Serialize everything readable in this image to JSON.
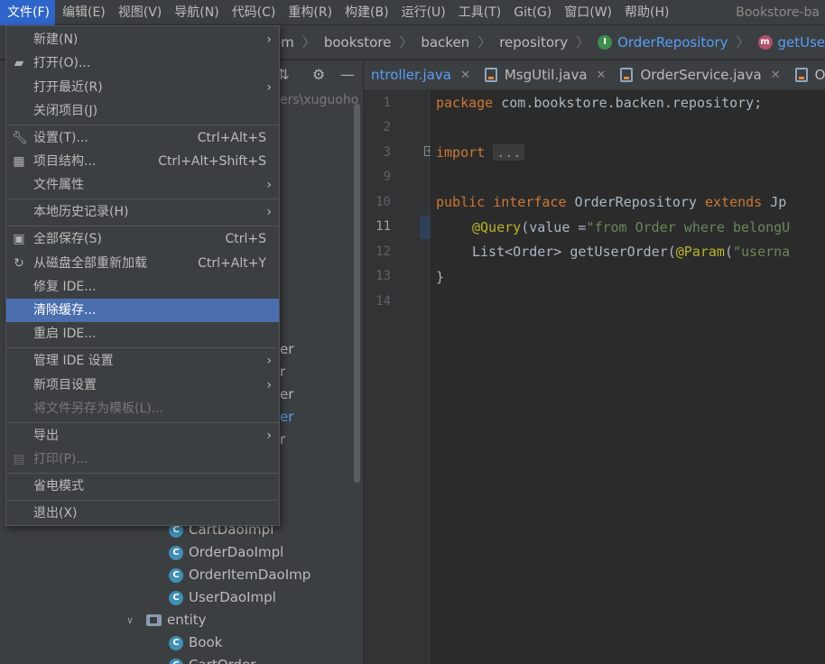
{
  "menubar": {
    "items": [
      "文件(F)",
      "编辑(E)",
      "视图(V)",
      "导航(N)",
      "代码(C)",
      "重构(R)",
      "构建(B)",
      "运行(U)",
      "工具(T)",
      "Git(G)",
      "窗口(W)",
      "帮助(H)"
    ],
    "window_title": "Bookstore-ba"
  },
  "breadcrumb": {
    "items": [
      "om",
      "bookstore",
      "backen",
      "repository"
    ],
    "interface": "OrderRepository",
    "method": "getUserOrder"
  },
  "project_pane": {
    "path_fragment": "ers\\xuguoho",
    "partial_rows": [
      "er",
      "r",
      "er",
      "er",
      "r"
    ],
    "tree": [
      {
        "label": "CartDaoImpl",
        "kind": "class"
      },
      {
        "label": "OrderDaoImpl",
        "kind": "class"
      },
      {
        "label": "OrderItemDaoImp",
        "kind": "class"
      },
      {
        "label": "UserDaoImpl",
        "kind": "class"
      },
      {
        "label": "entity",
        "kind": "package"
      },
      {
        "label": "Book",
        "kind": "class"
      },
      {
        "label": "CartOrder",
        "kind": "class"
      }
    ]
  },
  "tabs": [
    {
      "label": "ntroller.java",
      "active": true
    },
    {
      "label": "MsgUtil.java",
      "active": false
    },
    {
      "label": "OrderService.java",
      "active": false
    },
    {
      "label": "Or",
      "active": false
    }
  ],
  "editor": {
    "line_numbers": [
      "1",
      "2",
      "3",
      "9",
      "10",
      "11",
      "12",
      "13",
      "14"
    ],
    "current_line": "11",
    "lines": {
      "l1_kw": "package",
      "l1_rest": " com.bookstore.backen.repository;",
      "l3_kw": "import",
      "l3_fold": "...",
      "l10_kw1": "public",
      "l10_kw2": "interface",
      "l10_name": "OrderRepository",
      "l10_kw3": "extends",
      "l10_rest": "Jp",
      "l11_ann": "@Query",
      "l11_mid": "(value =",
      "l11_str": "\"from Order where belongU",
      "l12_a": "List<Order> getUserOrder(",
      "l12_ann": "@Param",
      "l12_b": "(",
      "l12_str": "\"userna",
      "l13": "}"
    }
  },
  "file_menu": {
    "items": [
      {
        "label": "新建(N)",
        "shortcut": "",
        "submenu": true,
        "icon": ""
      },
      {
        "label": "打开(O)...",
        "shortcut": "",
        "submenu": false,
        "icon": "folder-open-icon"
      },
      {
        "label": "打开最近(R)",
        "shortcut": "",
        "submenu": true,
        "icon": ""
      },
      {
        "label": "关闭项目(J)",
        "shortcut": "",
        "submenu": false,
        "icon": ""
      },
      {
        "label": "设置(T)...",
        "shortcut": "Ctrl+Alt+S",
        "submenu": false,
        "icon": "wrench-icon"
      },
      {
        "label": "项目结构...",
        "shortcut": "Ctrl+Alt+Shift+S",
        "submenu": false,
        "icon": "project-structure-icon"
      },
      {
        "label": "文件属性",
        "shortcut": "",
        "submenu": true,
        "icon": ""
      },
      {
        "label": "本地历史记录(H)",
        "shortcut": "",
        "submenu": true,
        "icon": ""
      },
      {
        "label": "全部保存(S)",
        "shortcut": "Ctrl+S",
        "submenu": false,
        "icon": "save-icon"
      },
      {
        "label": "从磁盘全部重新加载",
        "shortcut": "Ctrl+Alt+Y",
        "submenu": false,
        "icon": "reload-icon"
      },
      {
        "label": "修复 IDE...",
        "shortcut": "",
        "submenu": false,
        "icon": ""
      },
      {
        "label": "清除缓存...",
        "shortcut": "",
        "submenu": false,
        "icon": "",
        "highlight": true
      },
      {
        "label": "重启 IDE...",
        "shortcut": "",
        "submenu": false,
        "icon": ""
      },
      {
        "label": "管理 IDE 设置",
        "shortcut": "",
        "submenu": true,
        "icon": ""
      },
      {
        "label": "新项目设置",
        "shortcut": "",
        "submenu": true,
        "icon": ""
      },
      {
        "label": "将文件另存为模板(L)...",
        "shortcut": "",
        "submenu": false,
        "icon": "",
        "disabled": true
      },
      {
        "label": "导出",
        "shortcut": "",
        "submenu": true,
        "icon": ""
      },
      {
        "label": "打印(P)...",
        "shortcut": "",
        "submenu": false,
        "icon": "print-icon",
        "disabled": true
      },
      {
        "label": "省电模式",
        "shortcut": "",
        "submenu": false,
        "icon": ""
      },
      {
        "label": "退出(X)",
        "shortcut": "",
        "submenu": false,
        "icon": ""
      }
    ]
  },
  "colors": {
    "menu_active": "#2f65ca",
    "menu_highlight": "#4b6eaf",
    "keyword": "#cc7832",
    "string": "#6a8759",
    "annotation": "#bbb529",
    "link": "#589df6"
  }
}
